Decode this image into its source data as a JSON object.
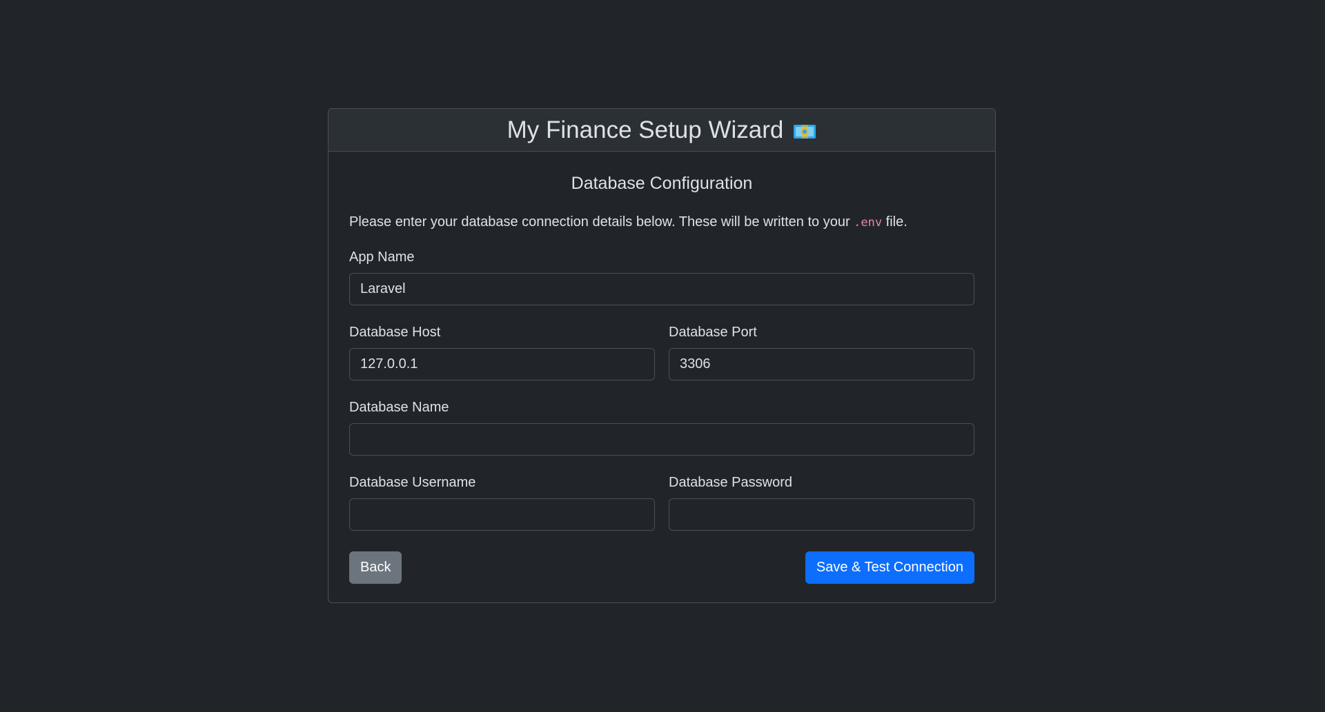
{
  "header": {
    "title": "My Finance Setup Wizard",
    "icon": "money-icon"
  },
  "section": {
    "title": "Database Configuration"
  },
  "intro": {
    "text_before": "Please enter your database connection details below. These will be written to your ",
    "code": ".env",
    "text_after": " file."
  },
  "fields": {
    "app_name": {
      "label": "App Name",
      "value": "Laravel"
    },
    "db_host": {
      "label": "Database Host",
      "value": "127.0.0.1"
    },
    "db_port": {
      "label": "Database Port",
      "value": "3306"
    },
    "db_name": {
      "label": "Database Name",
      "value": ""
    },
    "db_username": {
      "label": "Database Username",
      "value": ""
    },
    "db_password": {
      "label": "Database Password",
      "value": ""
    }
  },
  "actions": {
    "back_label": "Back",
    "save_label": "Save & Test Connection"
  },
  "colors": {
    "background": "#212529",
    "primary": "#0d6efd",
    "secondary": "#6c757d",
    "code": "#e685b5"
  }
}
